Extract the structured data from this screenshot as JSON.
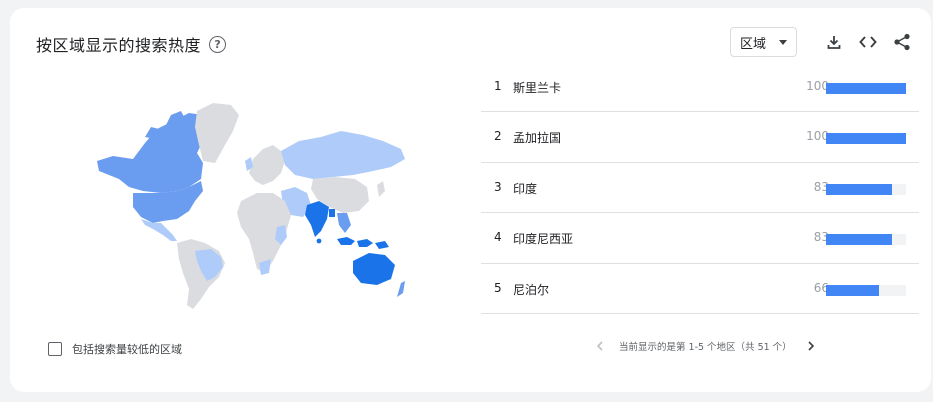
{
  "header": {
    "title": "按区域显示的搜索热度",
    "help": "?"
  },
  "controls": {
    "select_value": "区域"
  },
  "regions": [
    {
      "rank": "1",
      "name": "斯里兰卡",
      "value": 100
    },
    {
      "rank": "2",
      "name": "孟加拉国",
      "value": 100
    },
    {
      "rank": "3",
      "name": "印度",
      "value": 83
    },
    {
      "rank": "4",
      "name": "印度尼西亚",
      "value": 83
    },
    {
      "rank": "5",
      "name": "尼泊尔",
      "value": 66
    }
  ],
  "checkbox": {
    "label": "包括搜索量较低的区域"
  },
  "pager": {
    "text": "当前显示的是第 1-5 个地区（共 51 个）"
  },
  "colors": {
    "bar": "#4285f4",
    "map_dark": "#1a73e8",
    "map_mid": "#6a9cf0",
    "map_light": "#aecbfa",
    "map_none": "#dadce0"
  }
}
